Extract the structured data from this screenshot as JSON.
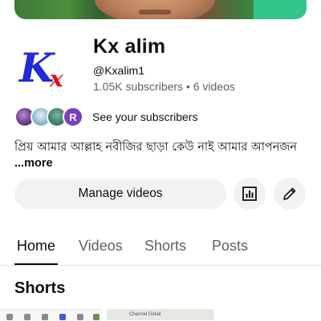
{
  "channel": {
    "name": "Kx alim",
    "handle": "@Kxalim1",
    "subscribers": "1.05K subscribers",
    "separator": "•",
    "videos": "6 videos"
  },
  "subscribers_link": {
    "label": "See your subscribers",
    "avatar_letter": "R"
  },
  "description": {
    "text": "প্রিয় আমার আল্লাহ নবীজির ছাড়া কেউ নাই আমার আপনজন",
    "more": "...more"
  },
  "actions": {
    "manage_label": "Manage videos",
    "analytics_icon": "analytics-icon",
    "edit_icon": "pencil-icon"
  },
  "tabs": [
    {
      "label": "Home",
      "active": true
    },
    {
      "label": "Videos",
      "active": false
    },
    {
      "label": "Shorts",
      "active": false
    },
    {
      "label": "Posts",
      "active": false
    }
  ],
  "section": {
    "title": "Shorts"
  },
  "shorts_preview": {
    "second_label": "Channel Detail"
  },
  "colors": {
    "logo_blue": "#1e2bd6",
    "logo_red": "#e0101f",
    "chip_bg": "#f2f2f2",
    "text_secondary": "#606060"
  }
}
